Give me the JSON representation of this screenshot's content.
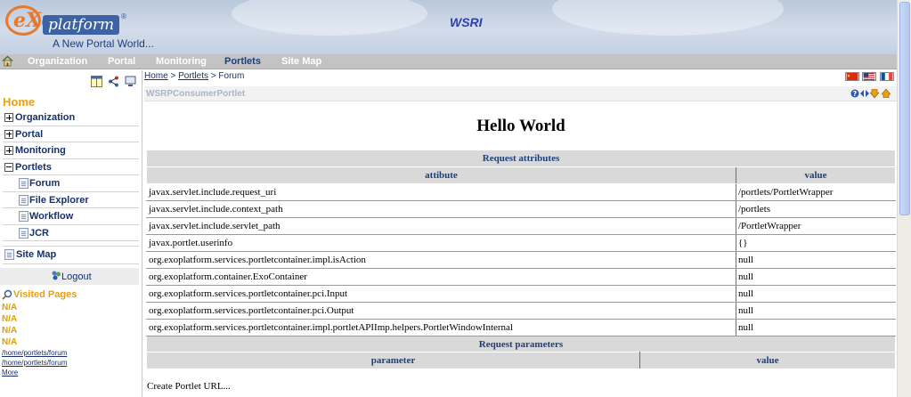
{
  "header": {
    "logo_e": "eXo",
    "logo_platform": "platform",
    "logo_reg": "®",
    "tagline": "A New Portal World...",
    "portal_title": "WSRI"
  },
  "nav": {
    "items": [
      "Organization",
      "Portal",
      "Monitoring",
      "Portlets",
      "Site Map"
    ],
    "active": "Portlets"
  },
  "sidebar": {
    "home_title": "Home",
    "menu": [
      {
        "label": "Organization",
        "toggle": "+"
      },
      {
        "label": "Portal",
        "toggle": "+"
      },
      {
        "label": "Monitoring",
        "toggle": "+"
      },
      {
        "label": "Portlets",
        "toggle": "-"
      },
      {
        "label": "Forum",
        "child": true
      },
      {
        "label": "File Explorer",
        "child": true
      },
      {
        "label": "Workflow",
        "child": true
      },
      {
        "label": "JCR",
        "child": true
      }
    ],
    "site_map": "Site Map",
    "logout": "Logout",
    "visited_title": "Visited Pages",
    "visited": [
      "N/A",
      "N/A",
      "N/A",
      "N/A"
    ],
    "visited_links": [
      "/home/portlets/forum",
      "/home/portlets/forum",
      "More"
    ]
  },
  "breadcrumb": {
    "home": "Home",
    "sep1": " > ",
    "portlets": "Portlets",
    "sep2": " > ",
    "current": "Forum"
  },
  "flags": [
    "cn-flag-icon",
    "us-flag-icon",
    "fr-flag-icon"
  ],
  "portlet": {
    "title": "WSRPConsumerPortlet",
    "hello": "Hello World",
    "request_attributes": {
      "caption": "Request attributes",
      "col_attr": "attibute",
      "col_value": "value",
      "rows": [
        {
          "name": "javax.servlet.include.request_uri",
          "value": "/portlets/PortletWrapper"
        },
        {
          "name": "javax.servlet.include.context_path",
          "value": "/portlets"
        },
        {
          "name": "javax.servlet.include.servlet_path",
          "value": "/PortletWrapper"
        },
        {
          "name": "javax.portlet.userinfo",
          "value": "{}"
        },
        {
          "name": "org.exoplatform.services.portletcontainer.impl.isAction",
          "value": "null"
        },
        {
          "name": "org.exoplatform.container.ExoContainer",
          "value": "null"
        },
        {
          "name": "org.exoplatform.services.portletcontainer.pci.Input",
          "value": "null"
        },
        {
          "name": "org.exoplatform.services.portletcontainer.pci.Output",
          "value": "null"
        },
        {
          "name": "org.exoplatform.services.portletcontainer.impl.portletAPIImp.helpers.PortletWindowInternal",
          "value": "null"
        }
      ]
    },
    "request_parameters": {
      "caption": "Request parameters",
      "col_param": "parameter",
      "col_value": "value"
    },
    "create_url": "Create Portlet URL..."
  },
  "colors": {
    "accent_orange": "#e8a011",
    "link_blue": "#17306a",
    "header_blue": "#1d3f7c"
  }
}
